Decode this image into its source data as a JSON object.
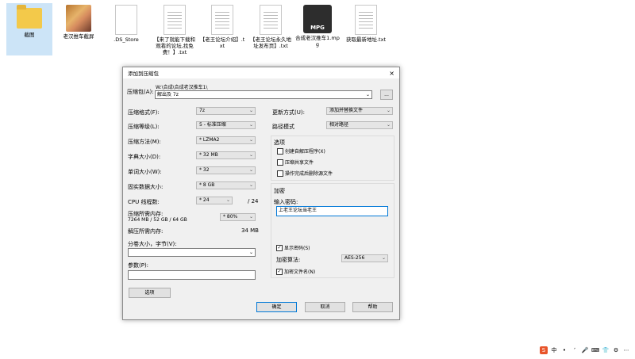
{
  "desktop": {
    "icons": [
      {
        "label": "截图",
        "type": "folder"
      },
      {
        "label": "老汉推车截屏",
        "type": "photo-folder"
      },
      {
        "label": ".DS_Store",
        "type": "blank"
      },
      {
        "label": "【来了就能下载和观看的论坛,找免费！】.txt",
        "type": "doc"
      },
      {
        "label": "【老王论坛介绍】.txt",
        "type": "doc"
      },
      {
        "label": "【老王论坛永久地址发布页】.txt",
        "type": "doc"
      },
      {
        "label": "合成老汉推车1.mpg",
        "type": "mpg"
      },
      {
        "label": "获取最新地址.txt",
        "type": "doc"
      }
    ],
    "mpg_badge": "MPG"
  },
  "dialog": {
    "title": "添加到压缩包",
    "close": "×",
    "archive_label": "压缩包(A):",
    "archive_path": "W:\\合成\\合成老汉推车1\\",
    "archive_name": "解出及 7z",
    "browse": "...",
    "left": {
      "format_label": "压缩格式(F):",
      "format_value": "7z",
      "level_label": "压缩等级(L):",
      "level_value": "5 - 标准压缩",
      "method_label": "压缩方法(M):",
      "method_value": "* LZMA2",
      "dict_label": "字典大小(D):",
      "dict_value": "* 32 MB",
      "word_label": "单词大小(W):",
      "word_value": "* 32",
      "solid_label": "固实数据大小:",
      "solid_value": "* 8 GB",
      "cpu_label": "CPU 线程数:",
      "cpu_value": "* 24",
      "cpu_total": "/ 24",
      "mem_label": "压缩所需内存:",
      "mem_detail": "7264 MB / 52 GB / 64 GB",
      "mem_value": "* 80%",
      "decomp_label": "解压所需内存:",
      "decomp_value": "34 MB",
      "split_label": "分卷大小，字节(V):",
      "params_label": "参数(P):",
      "options_button": "选项"
    },
    "right": {
      "update_label": "更新方式(U):",
      "update_value": "添加并替换文件",
      "path_label": "路径模式",
      "path_value": "相对路径",
      "options_title": "选项",
      "opt1": "创建自解压程序(X)",
      "opt2": "压缩共享文件",
      "opt3": "操作完成后删除源文件",
      "enc_title": "加密",
      "pwd_label": "输入密码:",
      "pwd_value": "上老王论坛当老王",
      "show_pwd": "显示密码(S)",
      "enc_method_label": "加密算法:",
      "enc_method_value": "AES-256",
      "enc_names": "加密文件名(N)"
    },
    "buttons": {
      "ok": "确定",
      "cancel": "取消",
      "help": "帮助"
    }
  },
  "tray": {
    "items": [
      "S",
      "中",
      "•",
      "ʼ",
      "🎤",
      "⌨",
      "👕",
      "⚙",
      "⋯"
    ]
  }
}
